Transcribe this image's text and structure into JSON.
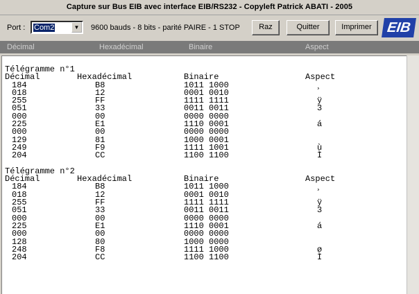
{
  "window": {
    "title": "Capture sur Bus EIB avec interface EIB/RS232  -  Copyleft Patrick ABATI  -  2005"
  },
  "toolbar": {
    "port_label": "Port :",
    "port_value": "Com2",
    "settings": "9600 bauds - 8 bits - parité PAIRE - 1 STOP",
    "raz_label": "Raz",
    "quitter_label": "Quitter",
    "imprimer_label": "Imprimer",
    "logo": "EIB"
  },
  "header": {
    "decimal": "Décimal",
    "hex": "Hexadécimal",
    "binary": "Binaire",
    "aspect": "Aspect"
  },
  "telegrams": [
    {
      "title": "Télégramme n°1",
      "columns": [
        "Décimal",
        "Hexadécimal",
        "Binaire",
        "Aspect"
      ],
      "rows": [
        [
          "184",
          "B8",
          "1011 1000",
          "¸"
        ],
        [
          "018",
          "12",
          "0001 0010",
          ""
        ],
        [
          "255",
          "FF",
          "1111 1111",
          "ÿ"
        ],
        [
          "051",
          "33",
          "0011 0011",
          "3"
        ],
        [
          "000",
          "00",
          "0000 0000",
          ""
        ],
        [
          "225",
          "E1",
          "1110 0001",
          "á"
        ],
        [
          "000",
          "00",
          "0000 0000",
          ""
        ],
        [
          "129",
          "81",
          "1000 0001",
          ""
        ],
        [
          "249",
          "F9",
          "1111 1001",
          "ù"
        ],
        [
          "204",
          "CC",
          "1100 1100",
          "Ì"
        ]
      ]
    },
    {
      "title": "Télégramme n°2",
      "columns": [
        "Décimal",
        "Hexadécimal",
        "Binaire",
        "Aspect"
      ],
      "rows": [
        [
          "184",
          "B8",
          "1011 1000",
          "¸"
        ],
        [
          "018",
          "12",
          "0001 0010",
          ""
        ],
        [
          "255",
          "FF",
          "1111 1111",
          "ÿ"
        ],
        [
          "051",
          "33",
          "0011 0011",
          "3"
        ],
        [
          "000",
          "00",
          "0000 0000",
          ""
        ],
        [
          "225",
          "E1",
          "1110 0001",
          "á"
        ],
        [
          "000",
          "00",
          "0000 0000",
          ""
        ],
        [
          "128",
          "80",
          "1000 0000",
          ""
        ],
        [
          "248",
          "F8",
          "1111 1000",
          "ø"
        ],
        [
          "204",
          "CC",
          "1100 1100",
          "Ì"
        ]
      ]
    }
  ]
}
